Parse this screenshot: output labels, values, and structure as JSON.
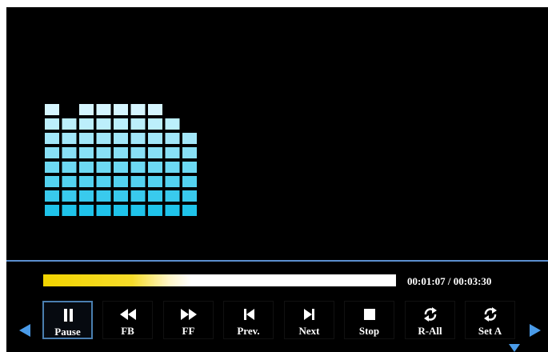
{
  "player": {
    "progress_fraction": 0.42,
    "time_display": "00:01:07 / 00:03:30",
    "controls": [
      {
        "key": "pause",
        "label": "Pause",
        "icon": "pause-icon",
        "active": true
      },
      {
        "key": "fb",
        "label": "FB",
        "icon": "rewind-icon"
      },
      {
        "key": "ff",
        "label": "FF",
        "icon": "fast-forward-icon"
      },
      {
        "key": "prev",
        "label": "Prev.",
        "icon": "previous-track-icon"
      },
      {
        "key": "next",
        "label": "Next",
        "icon": "next-track-icon"
      },
      {
        "key": "stop",
        "label": "Stop",
        "icon": "stop-icon"
      },
      {
        "key": "r-all",
        "label": "R-All",
        "icon": "repeat-all-icon"
      },
      {
        "key": "set-a",
        "label": "Set A",
        "icon": "repeat-ab-icon"
      }
    ],
    "nav": {
      "left": "left-arrow-icon",
      "right": "right-arrow-icon",
      "down": "down-arrow-icon"
    }
  },
  "visualizer": {
    "levels": [
      8,
      7,
      8,
      8,
      8,
      8,
      8,
      7,
      6
    ],
    "colors": {
      "top": "#1fc3ea",
      "bottom": "#d6f6ff"
    }
  },
  "colors": {
    "accent": "#5b8fd0",
    "progress": "#f2d400",
    "background": "#000000"
  }
}
